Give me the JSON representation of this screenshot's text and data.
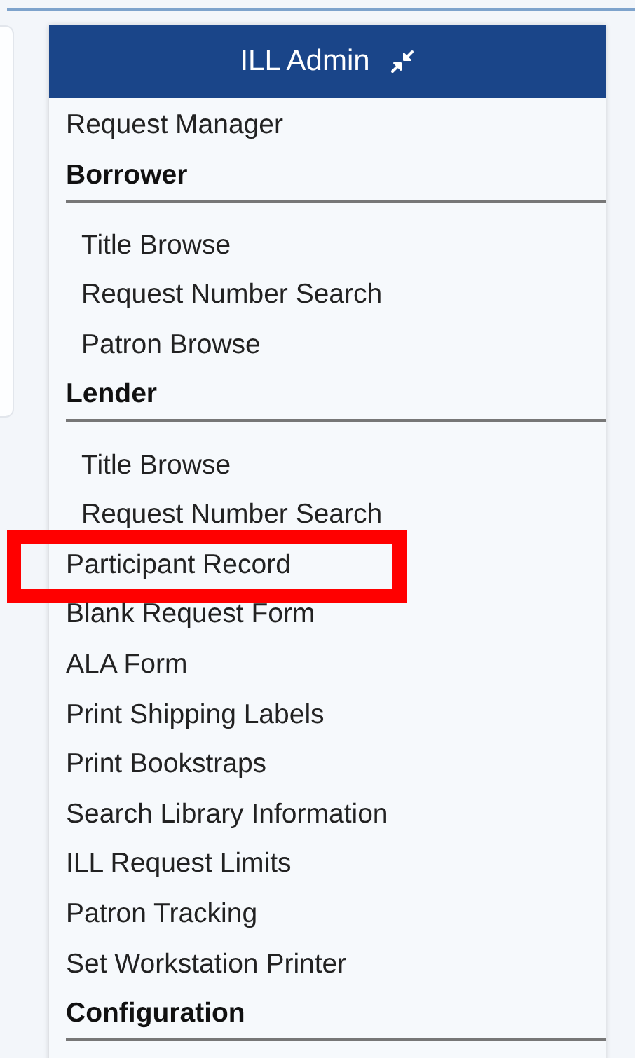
{
  "panel": {
    "title": "ILL Admin"
  },
  "items": [
    {
      "kind": "link",
      "label": "Request Manager",
      "highlighted": false
    },
    {
      "kind": "heading",
      "label": "Borrower"
    },
    {
      "kind": "sublink",
      "label": "Title Browse",
      "highlighted": false
    },
    {
      "kind": "sublink",
      "label": "Request Number Search",
      "highlighted": false
    },
    {
      "kind": "sublink",
      "label": "Patron Browse",
      "highlighted": false
    },
    {
      "kind": "heading",
      "label": "Lender"
    },
    {
      "kind": "sublink",
      "label": "Title Browse",
      "highlighted": false
    },
    {
      "kind": "sublink",
      "label": "Request Number Search",
      "highlighted": false
    },
    {
      "kind": "link",
      "label": "Participant Record",
      "highlighted": true
    },
    {
      "kind": "link",
      "label": "Blank Request Form",
      "highlighted": false
    },
    {
      "kind": "link",
      "label": "ALA Form",
      "highlighted": false
    },
    {
      "kind": "link",
      "label": "Print Shipping Labels",
      "highlighted": false
    },
    {
      "kind": "link",
      "label": "Print Bookstraps",
      "highlighted": false
    },
    {
      "kind": "link",
      "label": "Search Library Information",
      "highlighted": false
    },
    {
      "kind": "link",
      "label": "ILL Request Limits",
      "highlighted": false
    },
    {
      "kind": "link",
      "label": "Patron Tracking",
      "highlighted": false
    },
    {
      "kind": "link",
      "label": "Set Workstation Printer",
      "highlighted": false
    },
    {
      "kind": "heading",
      "label": "Configuration"
    }
  ]
}
